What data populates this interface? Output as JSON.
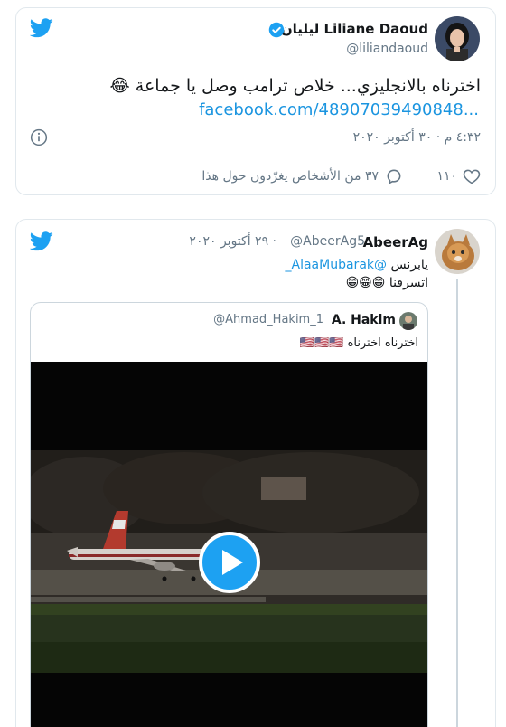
{
  "tweet1": {
    "author_name": "ليليان Liliane Daoud",
    "handle": "@liliandaoud",
    "text": "اخترناه بالانجليزي... خلاص ترامب وصل يا جماعة 😂",
    "link": "facebook.com/48907039490848...",
    "timestamp": "٤:٣٢ م · ٣٠ أكتوبر ٢٠٢٠",
    "likes": "١١٠",
    "replies_text": "٣٧ من الأشخاص يغرّدون حول هذا",
    "colors": {
      "link": "#1b95e0",
      "twitter_blue": "#1da1f2",
      "muted": "#657786"
    },
    "icons": [
      "twitter-bird-icon",
      "verified-badge-icon",
      "info-icon",
      "heart-icon",
      "comment-icon"
    ]
  },
  "tweet2": {
    "author_name": "AbeerAg",
    "handle": "@AbeerAg5",
    "date": "· ٢٩ أكتوبر ٢٠٢٠",
    "line1_prefix": "يابرنس",
    "mention": "@AlaaMubarak_",
    "line2": "اتسرقنا 😁😁😁",
    "quote": {
      "author_name": "A. Hakim",
      "handle": "@Ahmad_Hakim_1",
      "text": "اخترناه اخترناه 🇺🇸🇺🇸🇺🇸"
    },
    "video": {
      "playing": false
    }
  }
}
